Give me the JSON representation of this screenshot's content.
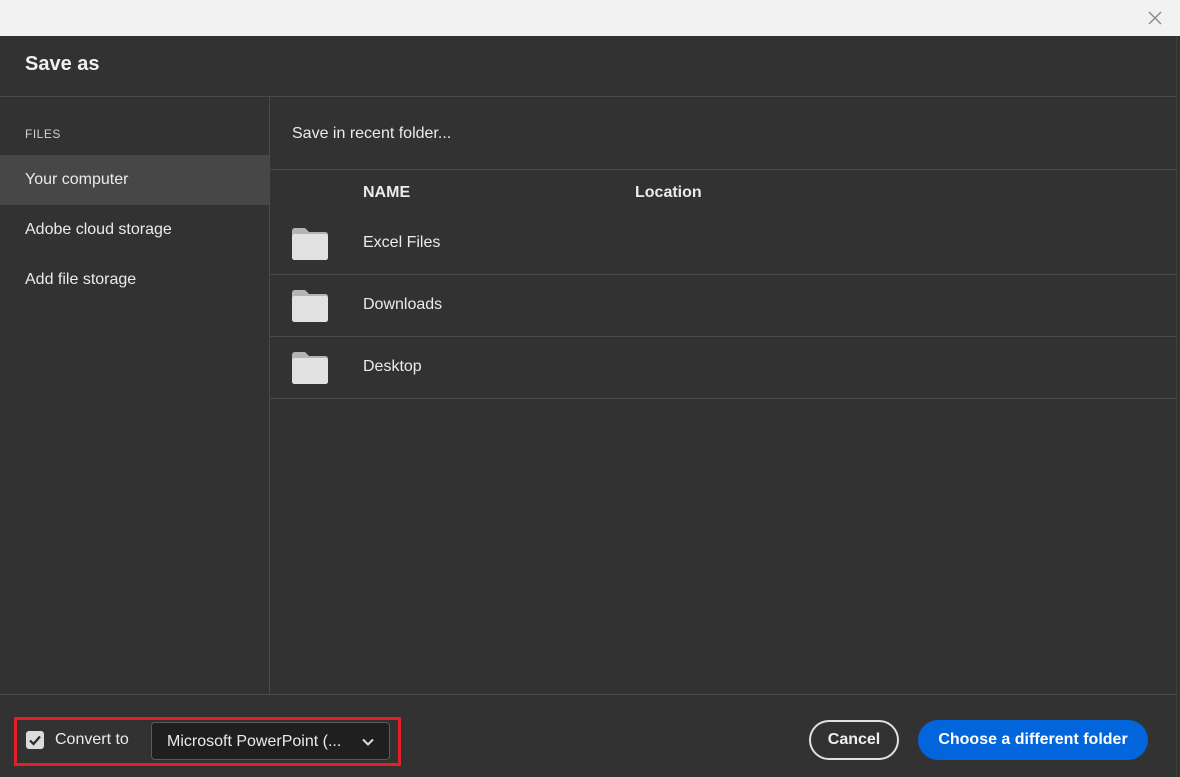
{
  "window": {
    "close_icon": "close-icon"
  },
  "dialog": {
    "title": "Save as"
  },
  "sidebar": {
    "heading": "FILES",
    "items": [
      {
        "label": "Your computer",
        "active": true
      },
      {
        "label": "Adobe cloud storage",
        "active": false
      },
      {
        "label": "Add file storage",
        "active": false
      }
    ]
  },
  "main": {
    "recent_label": "Save in recent folder...",
    "columns": {
      "name": "NAME",
      "location": "Location"
    },
    "rows": [
      {
        "icon": "folder-icon",
        "name": "Excel Files",
        "location": ""
      },
      {
        "icon": "folder-icon",
        "name": "Downloads",
        "location": ""
      },
      {
        "icon": "folder-icon",
        "name": "Desktop",
        "location": ""
      }
    ]
  },
  "footer": {
    "convert_checked": true,
    "convert_label": "Convert to",
    "convert_format": "Microsoft PowerPoint (...",
    "cancel_label": "Cancel",
    "primary_label": "Choose a different folder"
  },
  "colors": {
    "accent": "#0265dc",
    "highlight": "#e3202a",
    "background": "#323232"
  }
}
